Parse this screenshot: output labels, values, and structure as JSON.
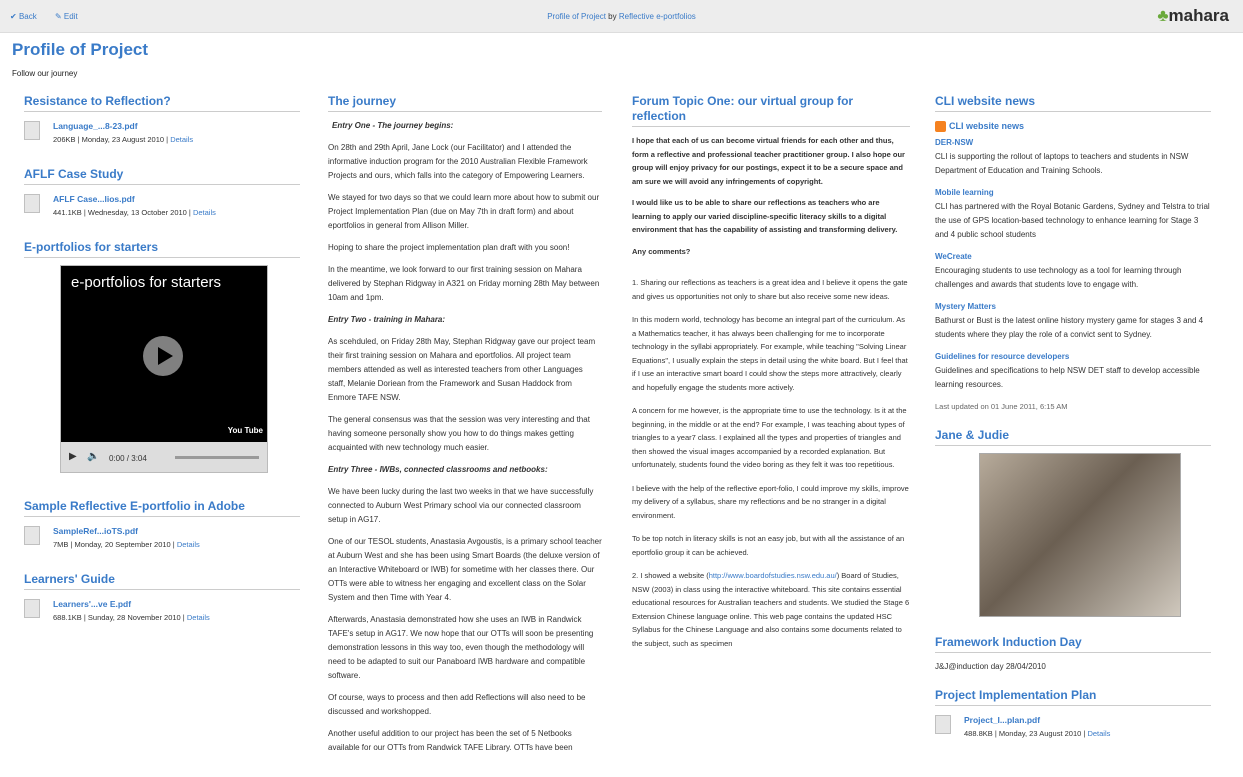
{
  "topbar": {
    "back": "Back",
    "edit": "Edit",
    "title_part1": "Profile of Project",
    "title_by": "by",
    "title_owner": "Reflective e-portfolios",
    "logo": "mahara"
  },
  "page": {
    "title": "Profile of Project",
    "intro": "Follow our journey"
  },
  "col1": {
    "resistance": {
      "title": "Resistance to Reflection?",
      "file": "Language_...8-23.pdf",
      "meta": "206KB | Monday, 23 August 2010 |",
      "details": "Details"
    },
    "aflf": {
      "title": "AFLF Case Study",
      "file": "AFLF Case...lios.pdf",
      "meta": "441.1KB | Wednesday, 13 October 2010 |",
      "details": "Details"
    },
    "eportfolios": {
      "title": "E-portfolios for starters",
      "video_title": "e-portfolios for starters",
      "video_brand": "You Tube",
      "video_time": "0:00 / 3:04"
    },
    "sample": {
      "title": "Sample Reflective E-portfolio in Adobe",
      "file": "SampleRef...ioTS.pdf",
      "meta": "7MB | Monday, 20 September 2010 |",
      "details": "Details"
    },
    "learners": {
      "title": "Learners' Guide",
      "file": "Learners'...ve E.pdf",
      "meta": "688.1KB | Sunday, 28 November 2010 |",
      "details": "Details"
    }
  },
  "col2": {
    "title": "The journey",
    "p": [
      "Entry One - The journey begins:",
      "On 28th and 29th April, Jane Lock (our Facilitator) and I attended the informative induction program for the 2010 Australian Flexible Framework Projects and ours, which falls into the category of Empowering Learners.",
      "We stayed for two days so that we could learn more about how to submit our Project Implementation Plan (due on May 7th in draft form) and about eportfolios in general from Allison Miller.",
      "Hoping to share the project implementation plan draft with you soon!",
      "In the meantime, we look forward to our first training session on Mahara delivered by Stephan Ridgway in A321 on Friday morning 28th May between 10am and 1pm.",
      "Entry Two - training in Mahara:",
      "As scehduled, on Friday 28th May, Stephan Ridgway gave our project team their first training session on Mahara and eportfolios. All project team members attended as well as interested teachers from other Languages staff, Melanie Doriean from the Framework and Susan Haddock from Enmore TAFE NSW.",
      "The general consensus was that the session was very interesting and that having someone personally show you how to do things makes getting acquainted with new technology much easier.",
      "Entry Three - IWBs, connected classrooms and netbooks:",
      "We have been lucky during the last two weeks in that we have successfully connected to Auburn West Primary school via our connected classroom setup in AG17.",
      "One of our TESOL students, Anastasia Avgoustis, is a primary school teacher at Auburn West and she has been using Smart Boards (the deluxe version of an Interactive Whiteboard or IWB) for sometime with her classes there. Our OTTs were able to witness her engaging and excellent class on the Solar System and then Time with Year 4.",
      "Afterwards, Anastasia demonstrated how she uses an IWB in Randwick TAFE's setup in AG17. We now hope that our OTTs will soon be presenting demonstration lessons in this way too, even though the methodology will need to be adapted to suit our Panaboard IWB hardware and compatible software.",
      "Of course, ways to process and then add Reflections will also need to be discussed and workshopped.",
      "Another useful addition to our project has been the set of 5 Netbooks available for our OTTs from Randwick TAFE Library. OTTs have been"
    ]
  },
  "col3": {
    "title": "Forum Topic One: our virtual group for reflection",
    "bold1": "I hope that each of us can become virtual friends for each other and thus, form a reflective and professional teacher practitioner group. I also hope our group will enjoy privacy for our postings, expect it to be a secure space and am sure we will avoid any infringements of copyright.",
    "bold2": "I would like us to be able to share our reflections as teachers who are learning to apply our varied discipline-specific literacy skills to a digital environment that has the capability of assisting and transforming delivery.",
    "bold3": "Any comments?",
    "p": [
      "1. Sharing our reflections as teachers is a great idea and I believe it opens the gate and gives us opportunities not only to share but also receive some new ideas.",
      "In this modern world, technology has become an integral part of the curriculum. As a Mathematics teacher, it has always been challenging for me to incorporate technology in the syllabi appropriately. For example, while teaching \"Solving Linear Equations\", I usually explain the steps in detail using the white board. But I feel that if I use an interactive smart board I could show the steps more attractively, clearly and hopefully engage the students more actively.",
      "A concern for me however, is the appropriate time to use the technology. Is it at the beginning, in the middle or at the end? For example, I was teaching about types of triangles to a year7 class. I explained all the types and properties of triangles and then showed the visual images accompanied by a recorded explanation. But unfortunately, students found the video boring as they felt it was too repetitious.",
      "I believe with the help of the reflective eport-folio, I could improve my skills, improve my delivery of a syllabus, share my reflections and be no stranger in a digital environment.",
      "To be top notch in literacy skills is not an easy job, but with all the assistance of an eportfolio group it can be achieved."
    ],
    "p_last_pre": "2. I showed a website (",
    "p_last_link": "http://www.boardofstudies.nsw.edu.au/",
    "p_last_post": ") Board of Studies, NSW (2003) in class using the interactive whiteboard. This site contains essential educational resources for Australian teachers and students. We studied the Stage 6 Extension Chinese language online. This web page contains the updated HSC Syllabus for the Chinese Language and also contains some documents related to the subject, such as specimen"
  },
  "col4": {
    "cli": {
      "title": "CLI website news",
      "feed_title": "CLI website news",
      "items": [
        {
          "t": "DER-NSW",
          "d": "CLI is supporting the rollout of laptops to teachers and students in NSW Department of Education and Training Schools."
        },
        {
          "t": "Mobile learning",
          "d": "CLI has partnered with the Royal Botanic Gardens, Sydney and Telstra to trial the use of GPS location-based technology to enhance learning for Stage 3 and 4 public school students"
        },
        {
          "t": "WeCreate",
          "d": "Encouraging students to use technology as a tool for learning through challenges and awards that students love to engage with."
        },
        {
          "t": "Mystery Matters",
          "d": "Bathurst or Bust is the latest online history mystery game for stages 3 and 4 students where they play the role of a convict sent to Sydney."
        },
        {
          "t": "Guidelines for resource developers",
          "d": "Guidelines and specifications to help NSW DET staff to develop accessible learning resources."
        }
      ],
      "updated": "Last updated on 01 June 2011, 6:15 AM"
    },
    "jane": {
      "title": "Jane & Judie"
    },
    "framework": {
      "title": "Framework Induction Day",
      "text": "J&J@induction day 28/04/2010"
    },
    "pip": {
      "title": "Project Implementation Plan",
      "file": "Project_I...plan.pdf",
      "meta": "488.8KB | Monday, 23 August 2010 |",
      "details": "Details"
    }
  }
}
